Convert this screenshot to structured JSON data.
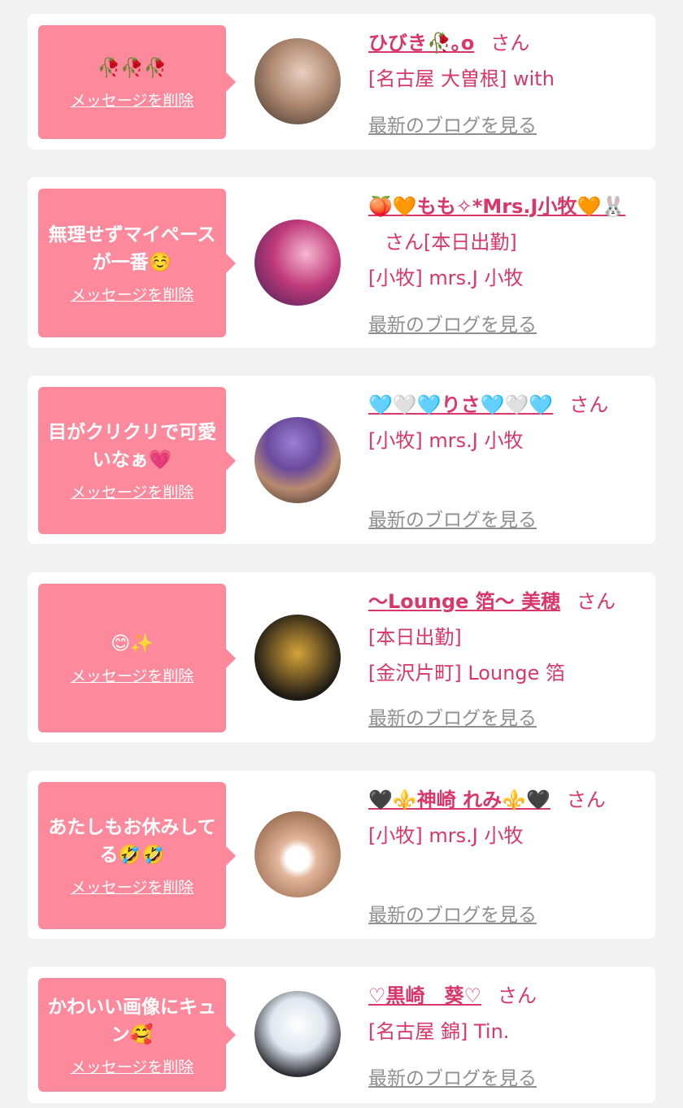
{
  "delete_label": "メッセージを削除",
  "blog_label": "最新のブログを見る",
  "san_label": "さん",
  "cards": [
    {
      "message": "🥀🥀🥀",
      "name": "ひびき🥀｡o",
      "details": [
        "[名古屋 大曽根] with"
      ]
    },
    {
      "message": "無理せずマイペースが一番☺️",
      "name": "🍑🧡もも✧*Mrs.J小牧🧡🐰",
      "details": [
        "[本日出勤]",
        "[小牧] mrs.J 小牧"
      ]
    },
    {
      "message": "目がクリクリで可愛いなぁ💗",
      "name": "🩵🤍🩵りさ🩵🤍🩵",
      "details": [
        "[小牧] mrs.J 小牧"
      ]
    },
    {
      "message": "😊✨",
      "name": "〜Lounge 箔〜 美穂",
      "details": [
        "[本日出勤]",
        "[金沢片町] Lounge 箔"
      ]
    },
    {
      "message": "あたしもお休みしてる🤣🤣",
      "name": "🖤⚜️神崎 れみ⚜️🖤",
      "details": [
        "[小牧] mrs.J 小牧"
      ]
    },
    {
      "message": "かわいい画像にキュン🥰",
      "name": "♡黒崎　葵♡",
      "details": [
        "[名古屋 錦] Tin."
      ]
    }
  ],
  "colors": {
    "bubble": "#fd8a9c",
    "accent": "#d9366a",
    "muted": "#8f8f8f",
    "background": "#f2f2f2"
  }
}
